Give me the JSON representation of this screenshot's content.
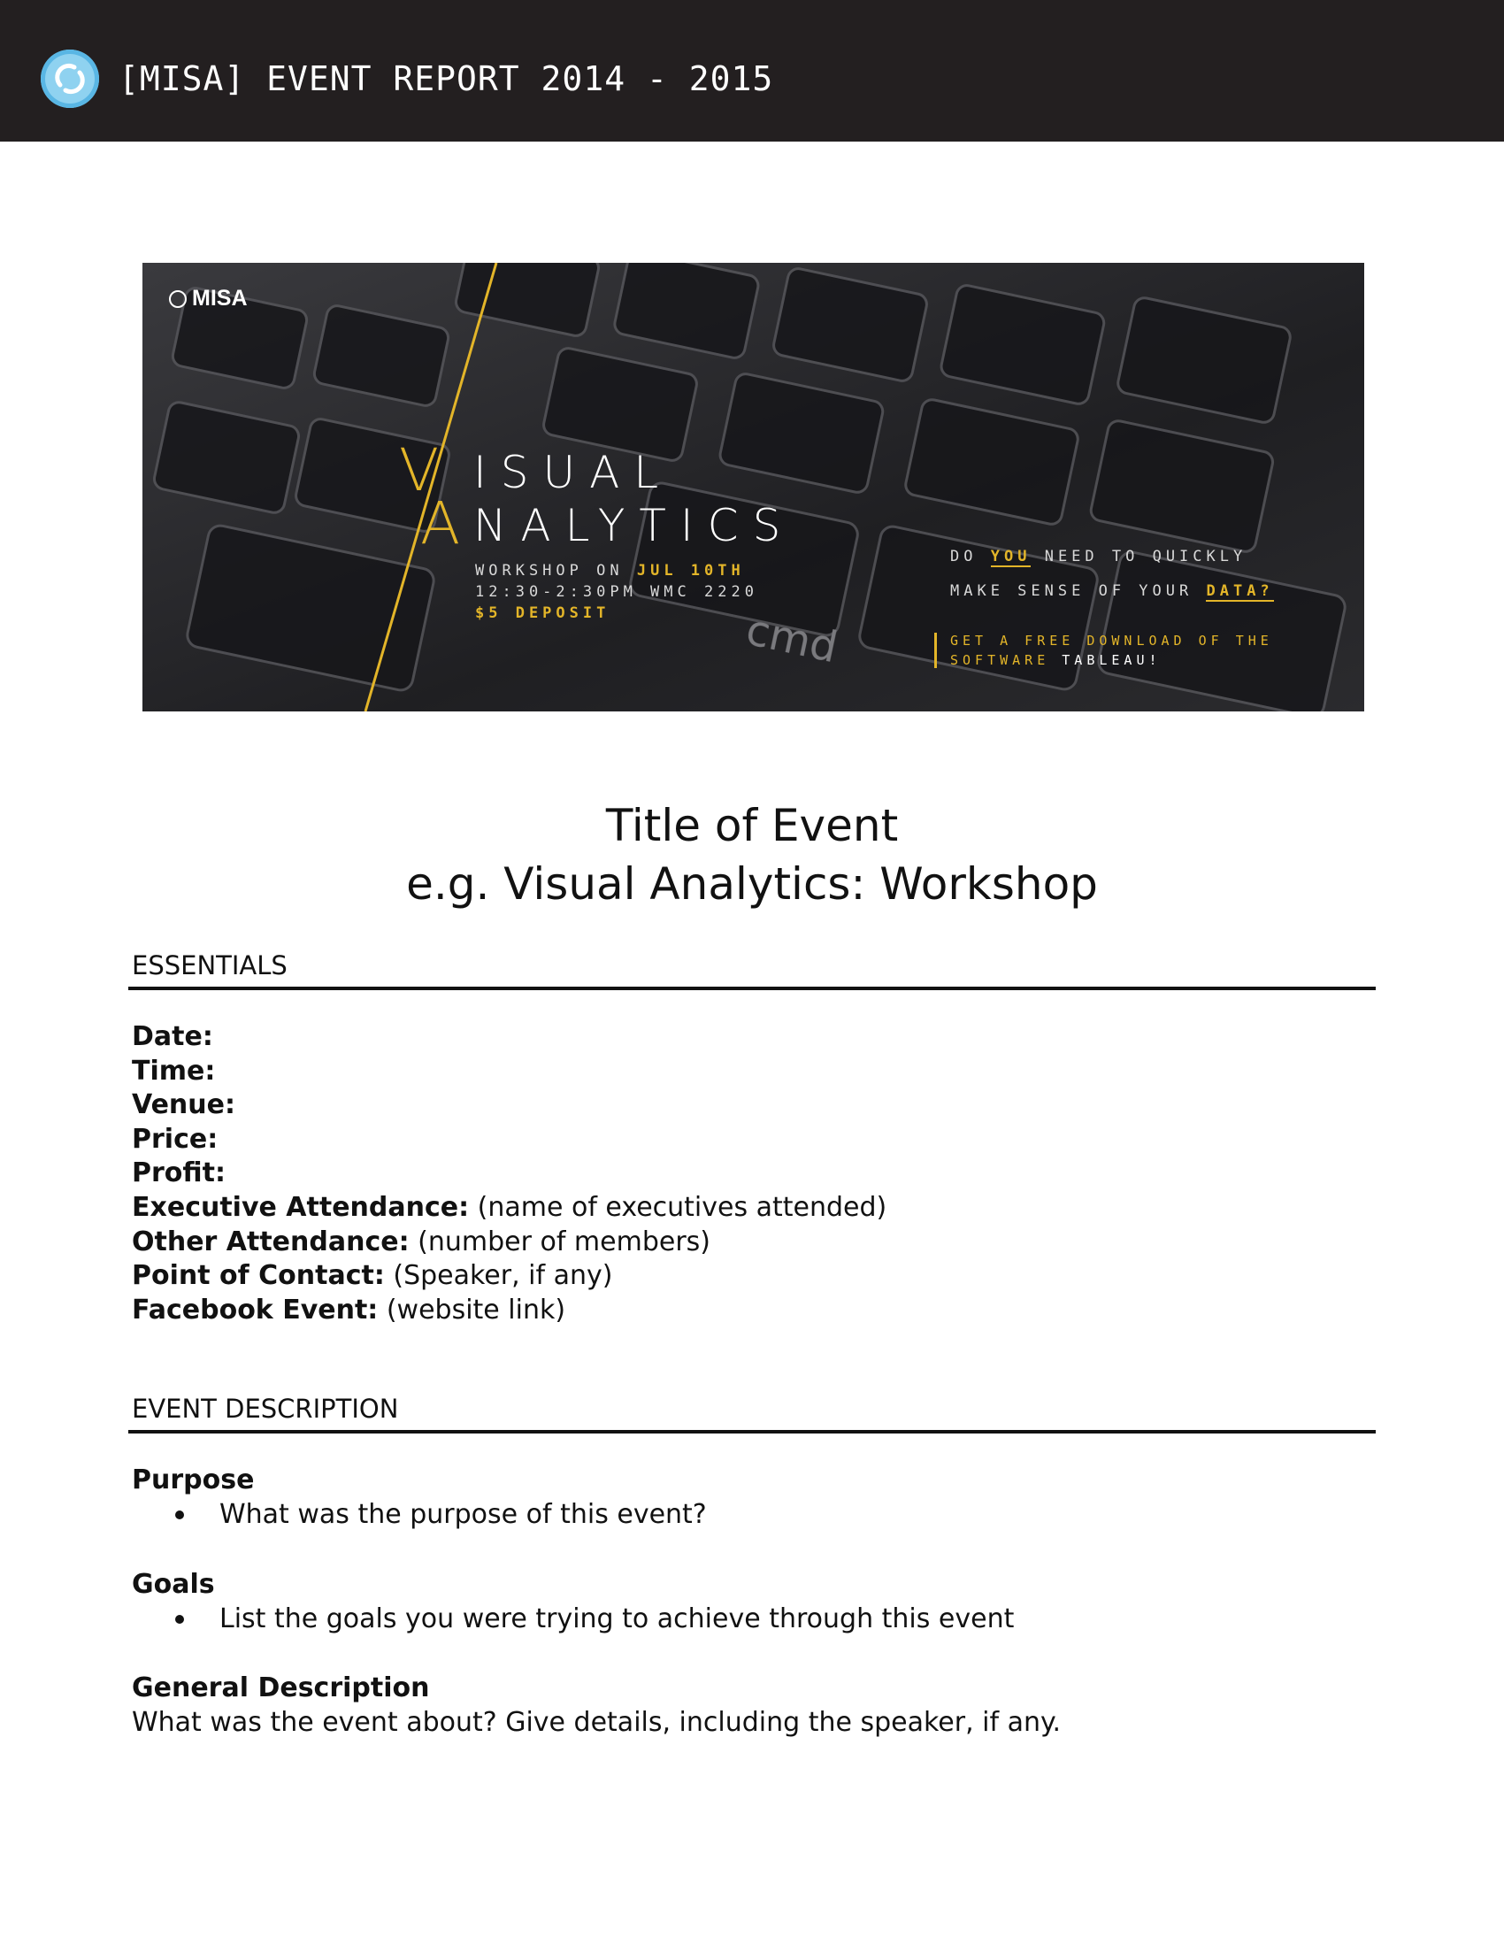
{
  "header": {
    "report_title": "[MISA] EVENT REPORT 2014 - 2015",
    "logo_icon": "misa-logo-icon",
    "background_color": "#231f20"
  },
  "banner": {
    "brand": "MISA",
    "title_line1": "ISUAL",
    "title_line1_initial": "V",
    "title_line2": "NALYTICS",
    "title_line2_initial": "A",
    "workshop_prefix": "WORKSHOP ON",
    "workshop_date": "JUL 10TH",
    "time_venue": "12:30-2:30PM  WMC 2220",
    "deposit": "$5 DEPOSIT",
    "question_part1": "DO",
    "question_you": "YOU",
    "question_part2": "NEED TO QUICKLY",
    "question_line2_prefix": "MAKE SENSE OF YOUR",
    "question_data": "DATA?",
    "offer_line1": "GET A FREE DOWNLOAD OF THE",
    "offer_line2_prefix": "SOFTWARE",
    "offer_line2_name": "TABLEAU!",
    "accent_color": "#e3b529"
  },
  "title": {
    "line1": "Title of Event",
    "line2": "e.g. Visual Analytics: Workshop"
  },
  "essentials": {
    "heading": "ESSENTIALS",
    "fields": [
      {
        "label": "Date:",
        "value": ""
      },
      {
        "label": "Time:",
        "value": ""
      },
      {
        "label": "Venue:",
        "value": ""
      },
      {
        "label": "Price:",
        "value": ""
      },
      {
        "label": "Profit:",
        "value": ""
      },
      {
        "label": "Executive Attendance:",
        "value": "(name of executives attended)"
      },
      {
        "label": "Other Attendance:",
        "value": "(number of members)"
      },
      {
        "label": "Point of Contact:",
        "value": "(Speaker, if any)"
      },
      {
        "label": "Facebook Event:",
        "value": "(website link)"
      }
    ]
  },
  "event_description": {
    "heading": "EVENT DESCRIPTION",
    "purpose": {
      "heading": "Purpose",
      "bullet": "What was the purpose of this event?"
    },
    "goals": {
      "heading": "Goals",
      "bullet": "List the goals you were trying to achieve through this event"
    },
    "general": {
      "heading": "General Description",
      "text": "What was the event about? Give details, including the speaker, if any."
    }
  }
}
